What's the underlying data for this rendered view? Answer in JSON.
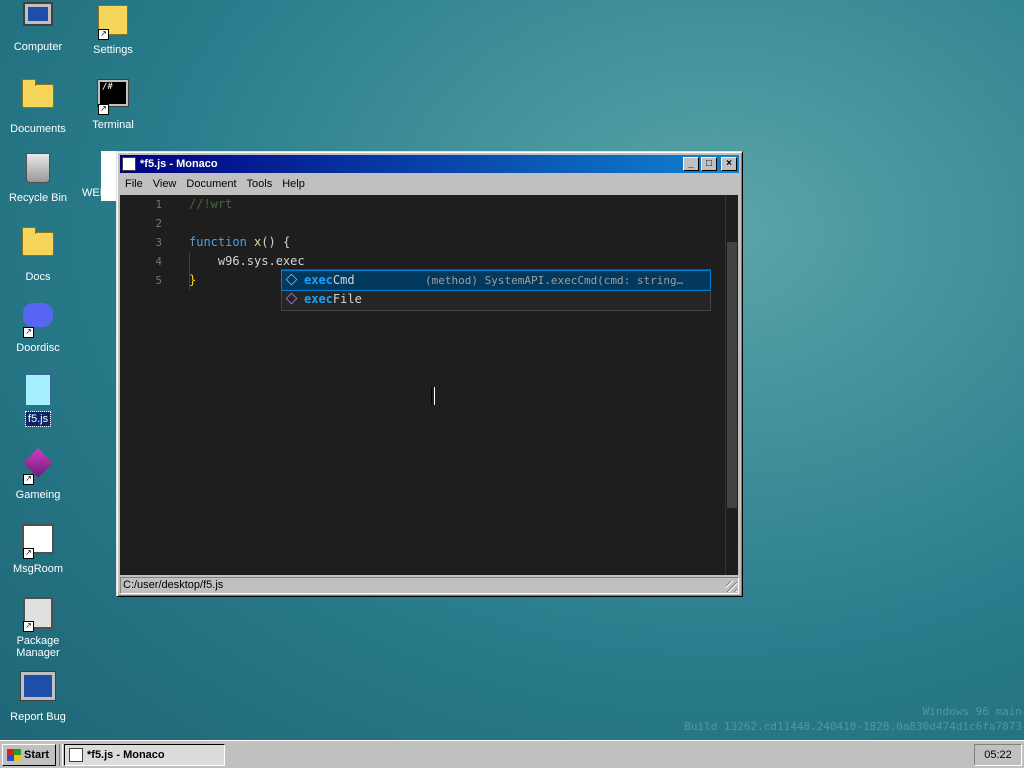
{
  "desktop": {
    "icons": [
      {
        "label": "Computer",
        "icon": "computer-icon"
      },
      {
        "label": "Settings",
        "icon": "settings-icon"
      },
      {
        "label": "Documents",
        "icon": "folder-icon"
      },
      {
        "label": "Terminal",
        "icon": "terminal-icon"
      },
      {
        "label": "Recycle Bin",
        "icon": "recycle-bin-icon"
      },
      {
        "label": "Docs",
        "icon": "folder-icon"
      },
      {
        "label": "Doordisc",
        "icon": "discord-icon"
      },
      {
        "label": "f5.js",
        "icon": "js-file-icon"
      },
      {
        "label": "Gameing",
        "icon": "cube-icon"
      },
      {
        "label": "MsgRoom",
        "icon": "chat-icon"
      },
      {
        "label": "Package Manager",
        "icon": "package-icon"
      },
      {
        "label": "Report Bug",
        "icon": "bug-report-icon"
      }
    ],
    "background_window_label": "WELCO",
    "watermark_line1": "Windows 96 main",
    "watermark_line2": "Build 13262.cd11448.240410-1828.0a830d474d1c6fa7873"
  },
  "editor_window": {
    "title": "*f5.js - Monaco",
    "controls": {
      "minimize": "_",
      "maximize": "□",
      "close": "×"
    },
    "menu": [
      "File",
      "View",
      "Document",
      "Tools",
      "Help"
    ],
    "lines": [
      {
        "num": "1",
        "text": "//!wrt"
      },
      {
        "num": "2",
        "text": ""
      },
      {
        "num": "3",
        "keyword": "function",
        "fn": "x",
        "rest": "() {"
      },
      {
        "num": "4",
        "text": "    w96.sys.exec"
      },
      {
        "num": "5",
        "text": "}"
      }
    ],
    "suggestions": [
      {
        "match": "exec",
        "rest": "Cmd",
        "detail": "(method) SystemAPI.execCmd(cmd: string…",
        "kind": "method-icon"
      },
      {
        "match": "exec",
        "rest": "File",
        "detail": "",
        "kind": "method-icon"
      }
    ],
    "status_path": "C:/user/desktop/f5.js"
  },
  "taskbar": {
    "start_label": "Start",
    "task_label": "*f5.js - Monaco",
    "clock": "05:22"
  }
}
